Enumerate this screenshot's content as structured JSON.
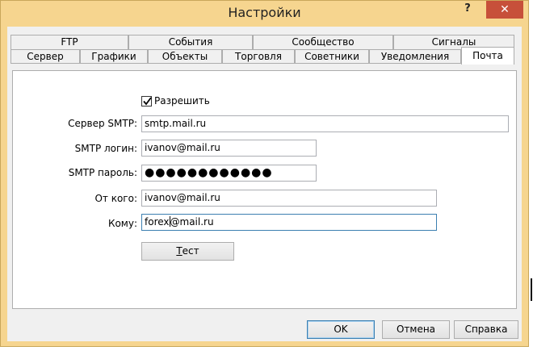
{
  "window": {
    "title": "Настройки",
    "help_label": "?",
    "close_label": "✕"
  },
  "tabs": {
    "row_back": [
      {
        "label": "FTP"
      },
      {
        "label": "События"
      },
      {
        "label": "Сообщество"
      },
      {
        "label": "Сигналы"
      }
    ],
    "row_front": [
      {
        "label": "Сервер"
      },
      {
        "label": "Графики"
      },
      {
        "label": "Объекты"
      },
      {
        "label": "Торговля"
      },
      {
        "label": "Советники"
      },
      {
        "label": "Уведомления"
      },
      {
        "label": "Почта"
      }
    ],
    "active": "Почта"
  },
  "mail": {
    "enable_label": "Разрешить",
    "enable_checked": true,
    "server_label": "Сервер SMTP:",
    "server_value": "smtp.mail.ru",
    "login_label": "SMTP логин:",
    "login_value": "ivanov@mail.ru",
    "password_label": "SMTP пароль:",
    "password_mask": "●●●●●●●●●●●●",
    "from_label": "От кого:",
    "from_value": "ivanov@mail.ru",
    "to_label": "Кому:",
    "to_value_before_caret": "forex",
    "to_value_after_caret": "@mail.ru",
    "test_button": "Тест",
    "test_button_mnemonic": "Т",
    "test_button_rest": "ест"
  },
  "footer": {
    "ok": "OK",
    "cancel": "Отмена",
    "help": "Справка"
  },
  "colors": {
    "titlebar": "#f6d58f",
    "close_button": "#c7503a",
    "focus_border": "#3c7fb1"
  }
}
